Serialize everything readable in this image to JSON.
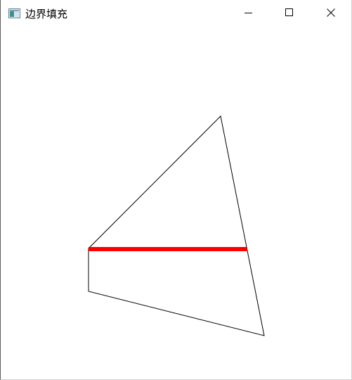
{
  "window": {
    "title": "边界填充"
  },
  "icons": {
    "app": "app-window-icon",
    "minimize": "minimize-icon",
    "maximize": "maximize-icon",
    "close": "close-icon"
  },
  "drawing": {
    "outline_color": "#000000",
    "fill_color": "#ff0000",
    "background_color": "#ffffff"
  }
}
